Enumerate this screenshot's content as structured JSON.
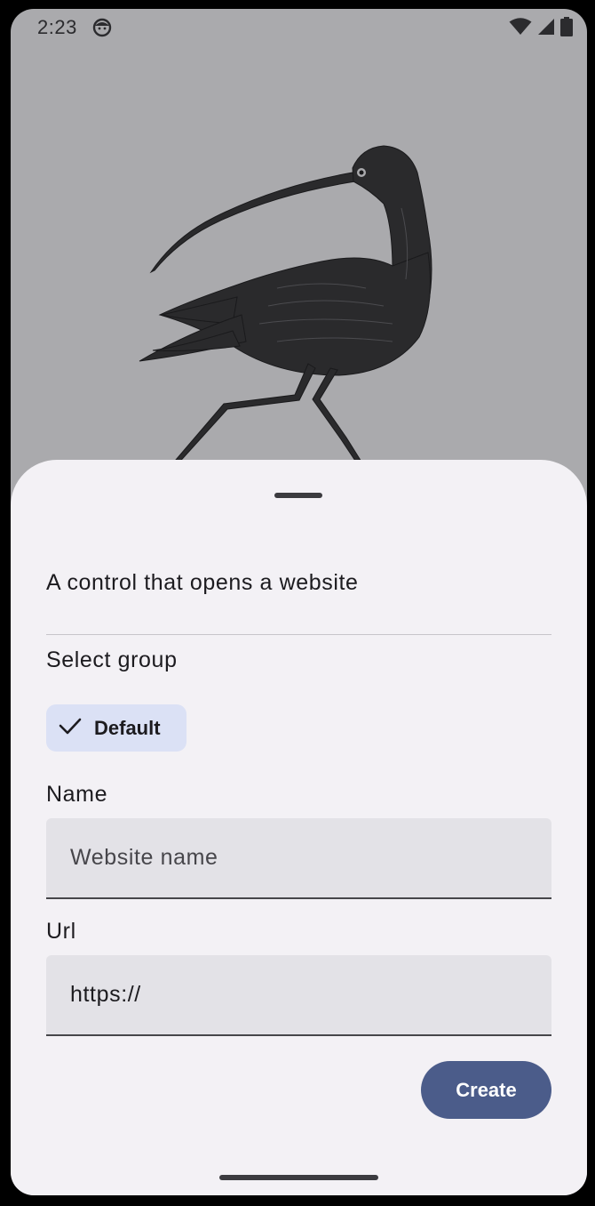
{
  "status_bar": {
    "time": "2:23",
    "icons": [
      "face-notification-icon",
      "wifi-icon",
      "cell-signal-icon",
      "battery-icon"
    ]
  },
  "background": {
    "image": "curlew-bird-illustration"
  },
  "sheet": {
    "description": "A control that opens a website",
    "group_label": "Select group",
    "group_chip": {
      "label": "Default",
      "selected": true,
      "icon": "check-icon"
    },
    "name_field": {
      "label": "Name",
      "placeholder": "Website name",
      "value": ""
    },
    "url_field": {
      "label": "Url",
      "placeholder": "",
      "value": "https://"
    },
    "create_button": {
      "label": "Create"
    }
  },
  "colors": {
    "sheet_background": "#f3f1f5",
    "chip_selected": "#dbe1f5",
    "field_background": "#e3e2e7",
    "primary_button": "#4b5c8a",
    "screen_background": "#aaaaad"
  }
}
